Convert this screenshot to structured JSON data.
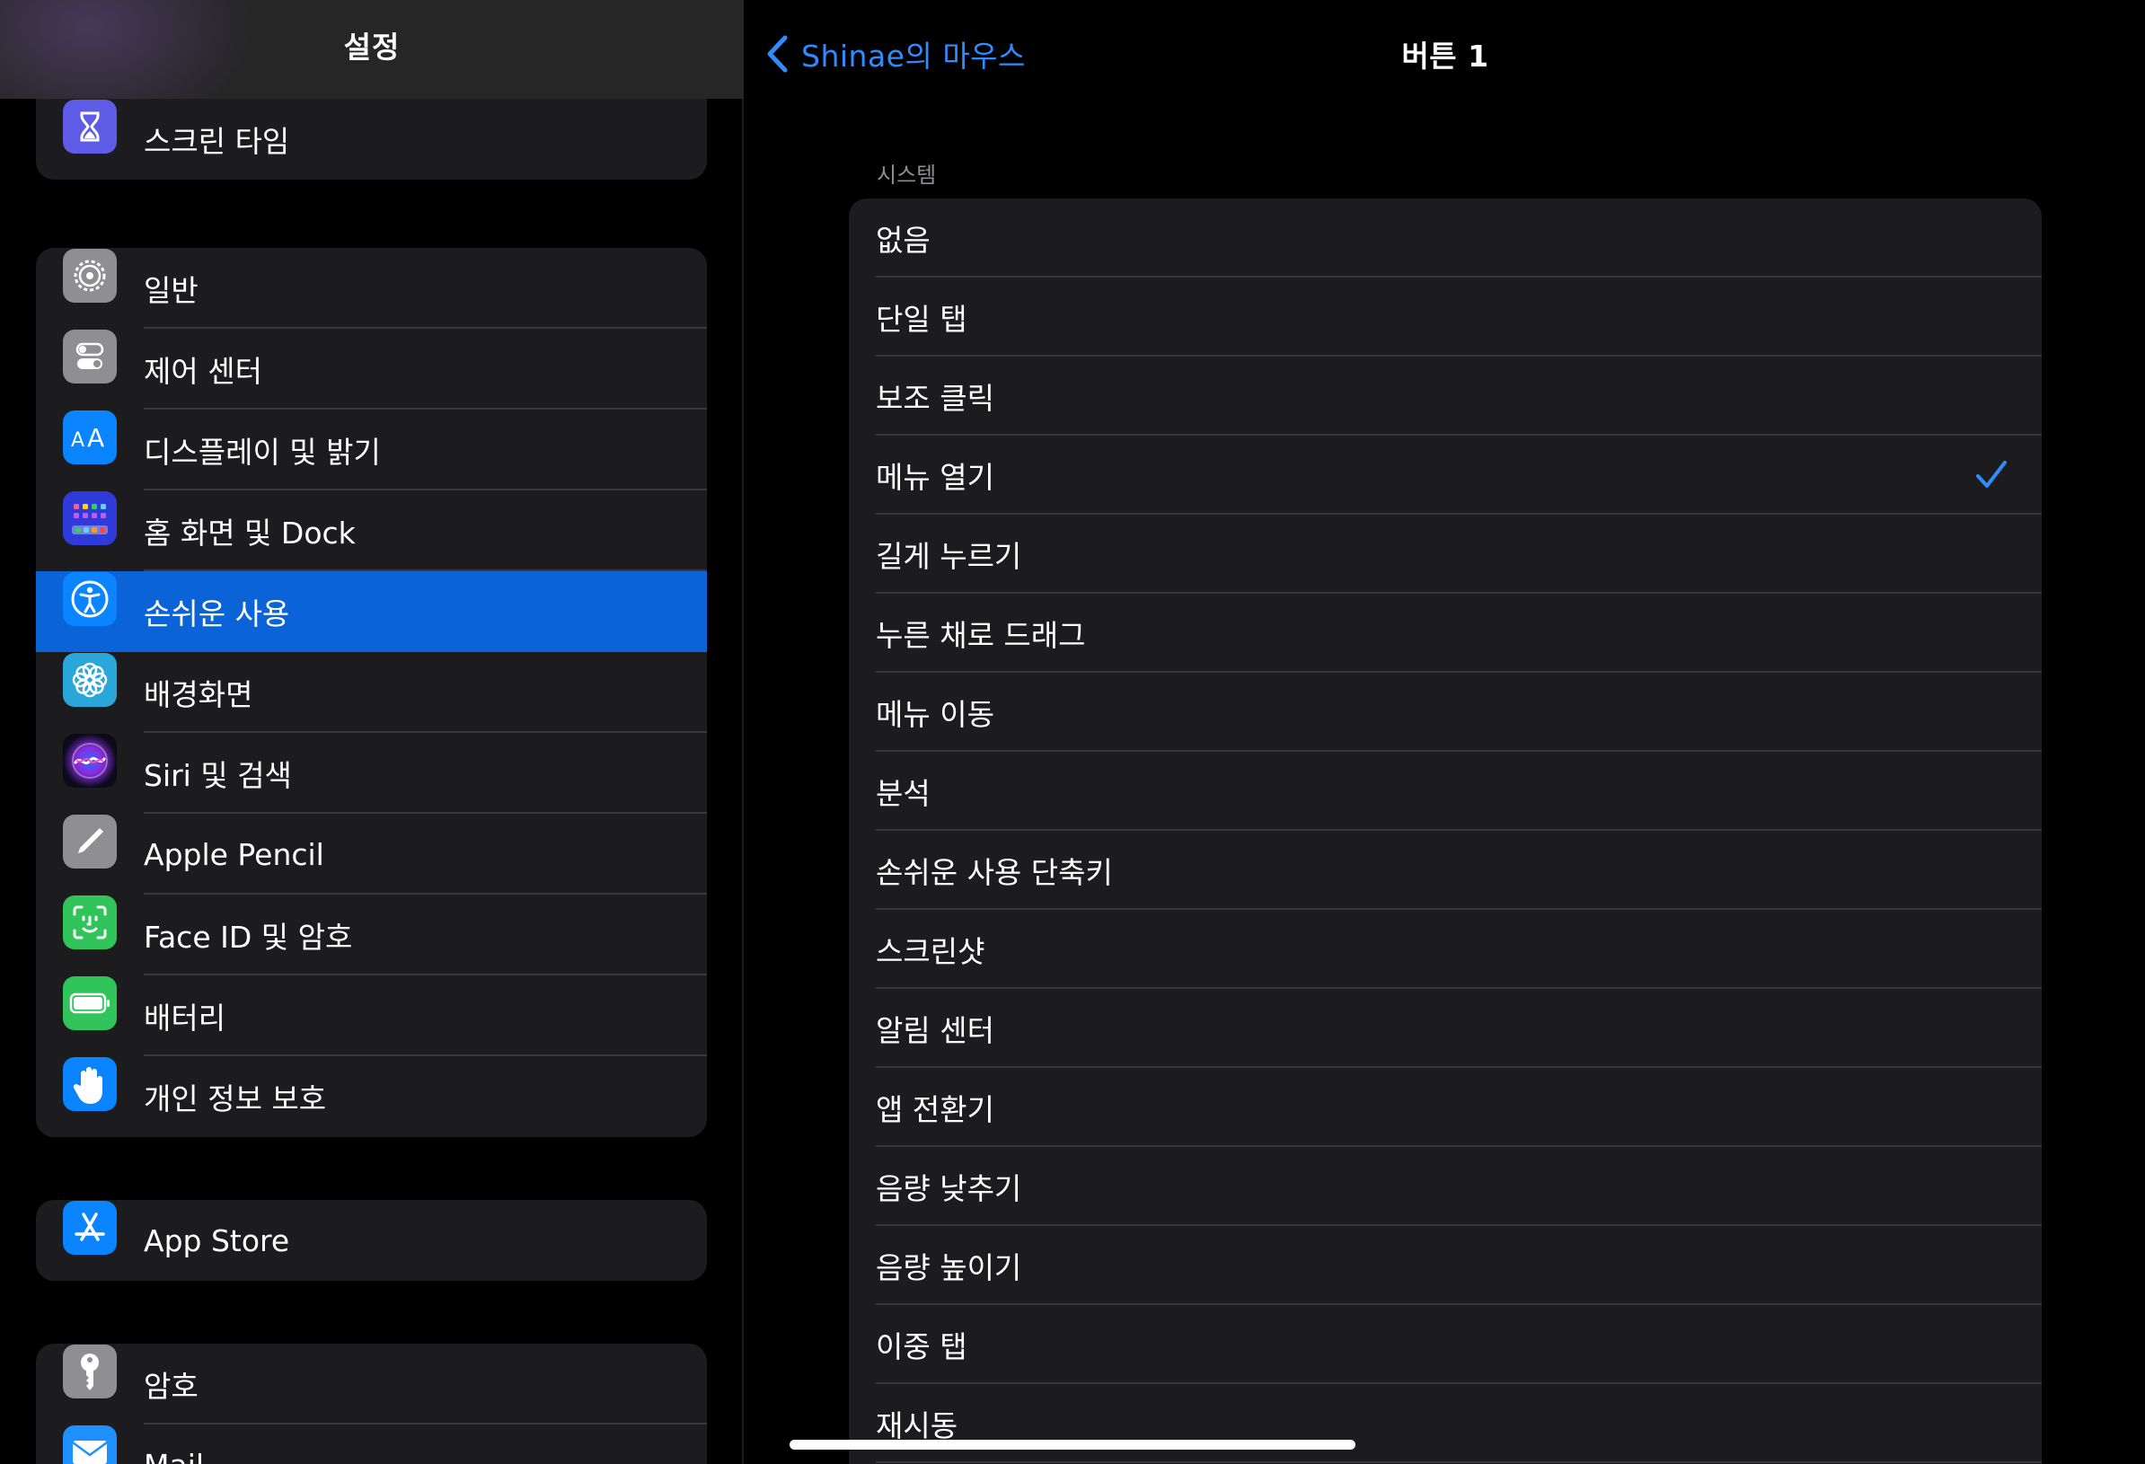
{
  "sidebar": {
    "title": "설정",
    "groups": [
      {
        "items": [
          {
            "label": "스크린 타임",
            "icon": "hourglass-icon",
            "color": "#5e5ce6"
          }
        ]
      },
      {
        "items": [
          {
            "label": "일반",
            "icon": "gear-icon",
            "color": "#8e8e93"
          },
          {
            "label": "제어 센터",
            "icon": "toggles-icon",
            "color": "#8e8e93"
          },
          {
            "label": "디스플레이 및 밝기",
            "icon": "text-size-icon",
            "color": "#0a84ff"
          },
          {
            "label": "홈 화면 및 Dock",
            "icon": "home-grid-icon",
            "color": "#2f3bd9"
          },
          {
            "label": "손쉬운 사용",
            "icon": "accessibility-icon",
            "color": "#0a84ff"
          },
          {
            "label": "배경화면",
            "icon": "flower-icon",
            "color": "#2aa7d9"
          },
          {
            "label": "Siri 및 검색",
            "icon": "siri-icon",
            "color": "#1b1b3a"
          },
          {
            "label": "Apple Pencil",
            "icon": "pencil-icon",
            "color": "#8e8e93"
          },
          {
            "label": "Face ID 및 암호",
            "icon": "face-id-icon",
            "color": "#30c45a"
          },
          {
            "label": "배터리",
            "icon": "battery-icon",
            "color": "#30c45a"
          },
          {
            "label": "개인 정보 보호",
            "icon": "hand-icon",
            "color": "#0a84ff"
          }
        ]
      },
      {
        "items": [
          {
            "label": "App Store",
            "icon": "app-store-icon",
            "color": "#0a84ff"
          }
        ]
      },
      {
        "items": [
          {
            "label": "암호",
            "icon": "key-icon",
            "color": "#8e8e93"
          },
          {
            "label": "Mail",
            "icon": "mail-icon",
            "color": "#1e90ff"
          }
        ]
      }
    ],
    "selected": "손쉬운 사용"
  },
  "detail": {
    "back_label": "Shinae의 마우스",
    "title": "버튼 1",
    "section_header": "시스템",
    "selected_option": "메뉴 열기",
    "accent_color": "#2f8cff",
    "options": [
      "없음",
      "단일 탭",
      "보조 클릭",
      "메뉴 열기",
      "길게 누르기",
      "누른 채로 드래그",
      "메뉴 이동",
      "분석",
      "손쉬운 사용 단축키",
      "스크린샷",
      "알림 센터",
      "앱 전환기",
      "음량 낮추기",
      "음량 높이기",
      "이중 탭",
      "재시동"
    ]
  }
}
